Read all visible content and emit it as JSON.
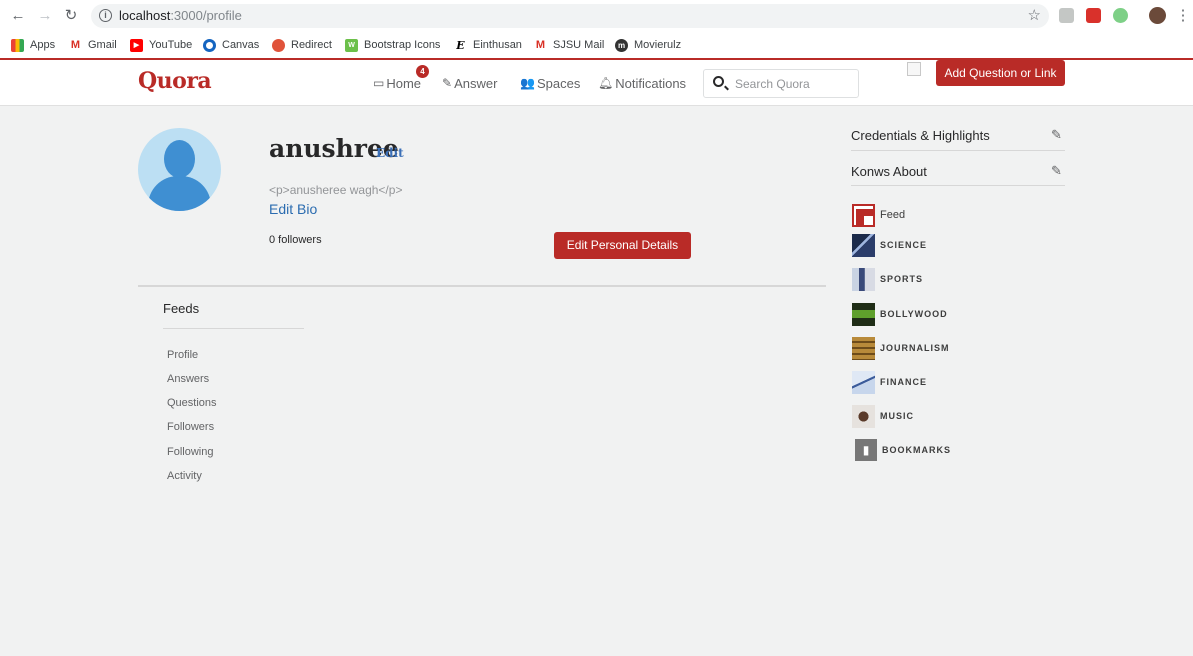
{
  "browser": {
    "url_host": "localhost",
    "url_path": ":3000/profile",
    "bookmarks": [
      "Apps",
      "Gmail",
      "YouTube",
      "Canvas",
      "Redirect",
      "Bootstrap Icons",
      "Einthusan",
      "SJSU Mail",
      "Movierulz"
    ]
  },
  "header": {
    "logo": "Quora",
    "nav": [
      "Home",
      "Answer",
      "Spaces",
      "Notifications"
    ],
    "home_badge": "4",
    "search_placeholder": "Search Quora",
    "add_button": "Add Question or Link"
  },
  "profile": {
    "name": "anushree",
    "name_edit": "Edit",
    "bio": "<p>anusheree wagh</p>",
    "edit_bio": "Edit Bio",
    "followers": "0 followers",
    "edit_details": "Edit Personal Details"
  },
  "feeds": {
    "title": "Feeds",
    "links": [
      "Profile",
      "Answers",
      "Questions",
      "Followers",
      "Following",
      "Activity"
    ]
  },
  "sidebar": {
    "credentials": "Credentials & Highlights",
    "knows_about": "Konws About",
    "topics": [
      {
        "label": "Feed",
        "icon": "feed-icon"
      },
      {
        "label": "SCIENCE",
        "icon": "science-icon"
      },
      {
        "label": "SPORTS",
        "icon": "sports-icon"
      },
      {
        "label": "BOLLYWOOD",
        "icon": "bollywood-icon"
      },
      {
        "label": "JOURNALISM",
        "icon": "journalism-icon"
      },
      {
        "label": "FINANCE",
        "icon": "finance-icon"
      },
      {
        "label": "MUSIC",
        "icon": "music-icon"
      },
      {
        "label": "BOOKMARKS",
        "icon": "bookmark-icon"
      }
    ]
  },
  "colors": {
    "brand": "#b92b27",
    "link": "#2b6cb0",
    "background": "#f1f2f2"
  }
}
